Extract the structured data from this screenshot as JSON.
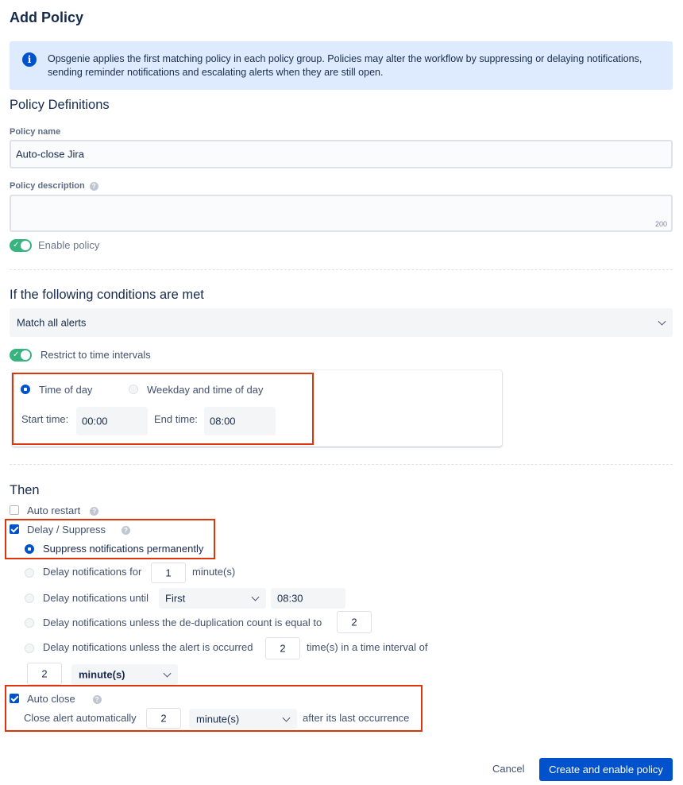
{
  "page_title": "Add Policy",
  "info": {
    "icon": "info-icon",
    "text": "Opsgenie applies the first matching policy in each policy group. Policies may alter the workflow by suppressing or delaying notifications, sending reminder notifications and escalating alerts when they are still open."
  },
  "definitions": {
    "heading": "Policy Definitions",
    "name_label": "Policy name",
    "name_value": "Auto-close Jira",
    "description_label": "Policy description",
    "description_counter": "200",
    "enable_label": "Enable policy"
  },
  "conditions": {
    "heading": "If the following conditions are met",
    "match_value": "Match all alerts",
    "restrict_label": "Restrict to time intervals",
    "time_of_day_label": "Time of day",
    "weekday_label": "Weekday and time of day",
    "start_label": "Start time:",
    "start_value": "00:00",
    "end_label": "End time:",
    "end_value": "08:00"
  },
  "then": {
    "heading": "Then",
    "auto_restart_label": "Auto restart",
    "delay_suppress_label": "Delay / Suppress",
    "suppress_label": "Suppress notifications permanently",
    "delay_for_label": "Delay notifications for",
    "delay_for_value": "1",
    "delay_for_unit": "minute(s)",
    "delay_until_label": "Delay notifications until",
    "delay_until_select": "First",
    "delay_until_time": "08:30",
    "dedup_label": "Delay notifications unless the de-duplication count is equal to",
    "dedup_value": "2",
    "occurred_label": "Delay notifications unless the alert is occurred",
    "occurred_value": "2",
    "occurred_suffix": "time(s) in a time interval of",
    "interval_value": "2",
    "interval_unit": "minute(s)",
    "auto_close_label": "Auto close",
    "close_prefix": "Close alert automatically",
    "close_value": "2",
    "close_unit": "minute(s)",
    "close_suffix": "after its last occurrence"
  },
  "footer": {
    "cancel_label": "Cancel",
    "create_label": "Create and enable policy"
  },
  "colors": {
    "primary": "#0052cc",
    "highlight": "#de350b",
    "toggle_on": "#36b37e",
    "info_bg": "#deebff"
  }
}
